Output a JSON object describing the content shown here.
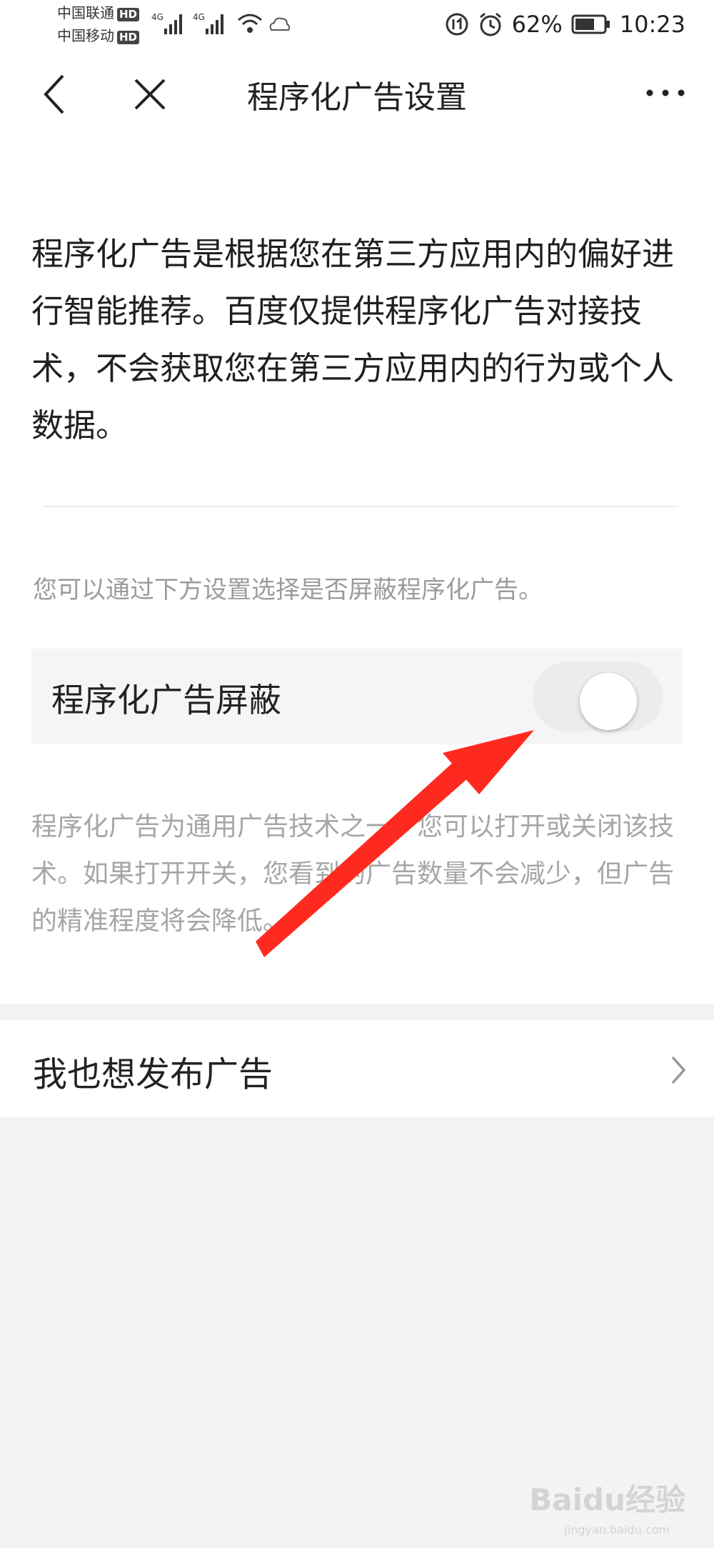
{
  "status_bar": {
    "carrier1": "中国联通",
    "carrier2": "中国移动",
    "hd": "HD",
    "net": "4G",
    "battery": "62%",
    "time": "10:23"
  },
  "nav": {
    "title": "程序化广告设置"
  },
  "intro": {
    "text": "程序化广告是根据您在第三方应用内的偏好进行智能推荐。百度仅提供程序化广告对接技术，不会获取您在第三方应用内的行为或个人数据。"
  },
  "hint": "您可以通过下方设置选择是否屏蔽程序化广告。",
  "toggle": {
    "label": "程序化广告屏蔽",
    "on": false
  },
  "note": "程序化广告为通用广告技术之一，您可以打开或关闭该技术。如果打开开关，您看到的广告数量不会减少，但广告的精准程度将会降低。",
  "publish": {
    "label": "我也想发布广告"
  },
  "watermark": {
    "brand": "Baidu经验",
    "url": "jingyan.baidu.com"
  },
  "colors": {
    "annotation_arrow": "#ff2a1f",
    "background": "#f3f3f3"
  }
}
